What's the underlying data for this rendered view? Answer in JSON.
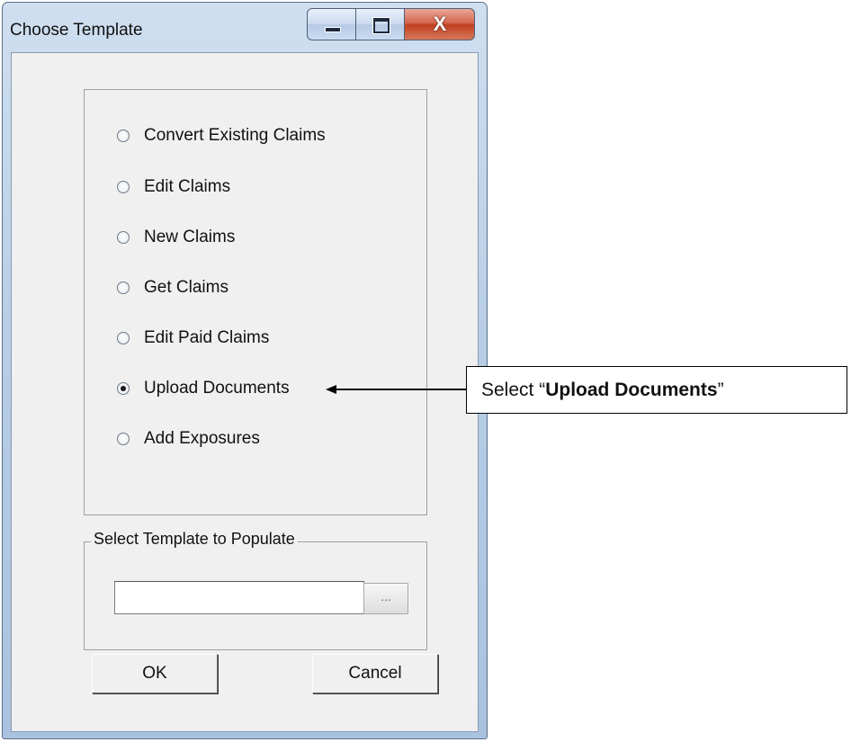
{
  "window": {
    "title": "Choose Template",
    "caption_buttons": {
      "minimize": "minimize-icon",
      "maximize": "maximize-icon",
      "close": "close-icon",
      "close_glyph": "X"
    }
  },
  "options": [
    {
      "label": "Convert Existing Claims",
      "checked": false
    },
    {
      "label": "Edit Claims",
      "checked": false
    },
    {
      "label": "New Claims",
      "checked": false
    },
    {
      "label": "Get Claims",
      "checked": false
    },
    {
      "label": "Edit Paid Claims",
      "checked": false
    },
    {
      "label": "Upload Documents",
      "checked": true
    },
    {
      "label": "Add Exposures",
      "checked": false
    }
  ],
  "template_group": {
    "legend": "Select Template to Populate",
    "path_value": "",
    "browse_label": "..."
  },
  "buttons": {
    "ok_label": "OK",
    "cancel_label": "Cancel"
  },
  "annotation": {
    "prefix": "Select “",
    "emphasis": "Upload Documents",
    "suffix": "”"
  }
}
